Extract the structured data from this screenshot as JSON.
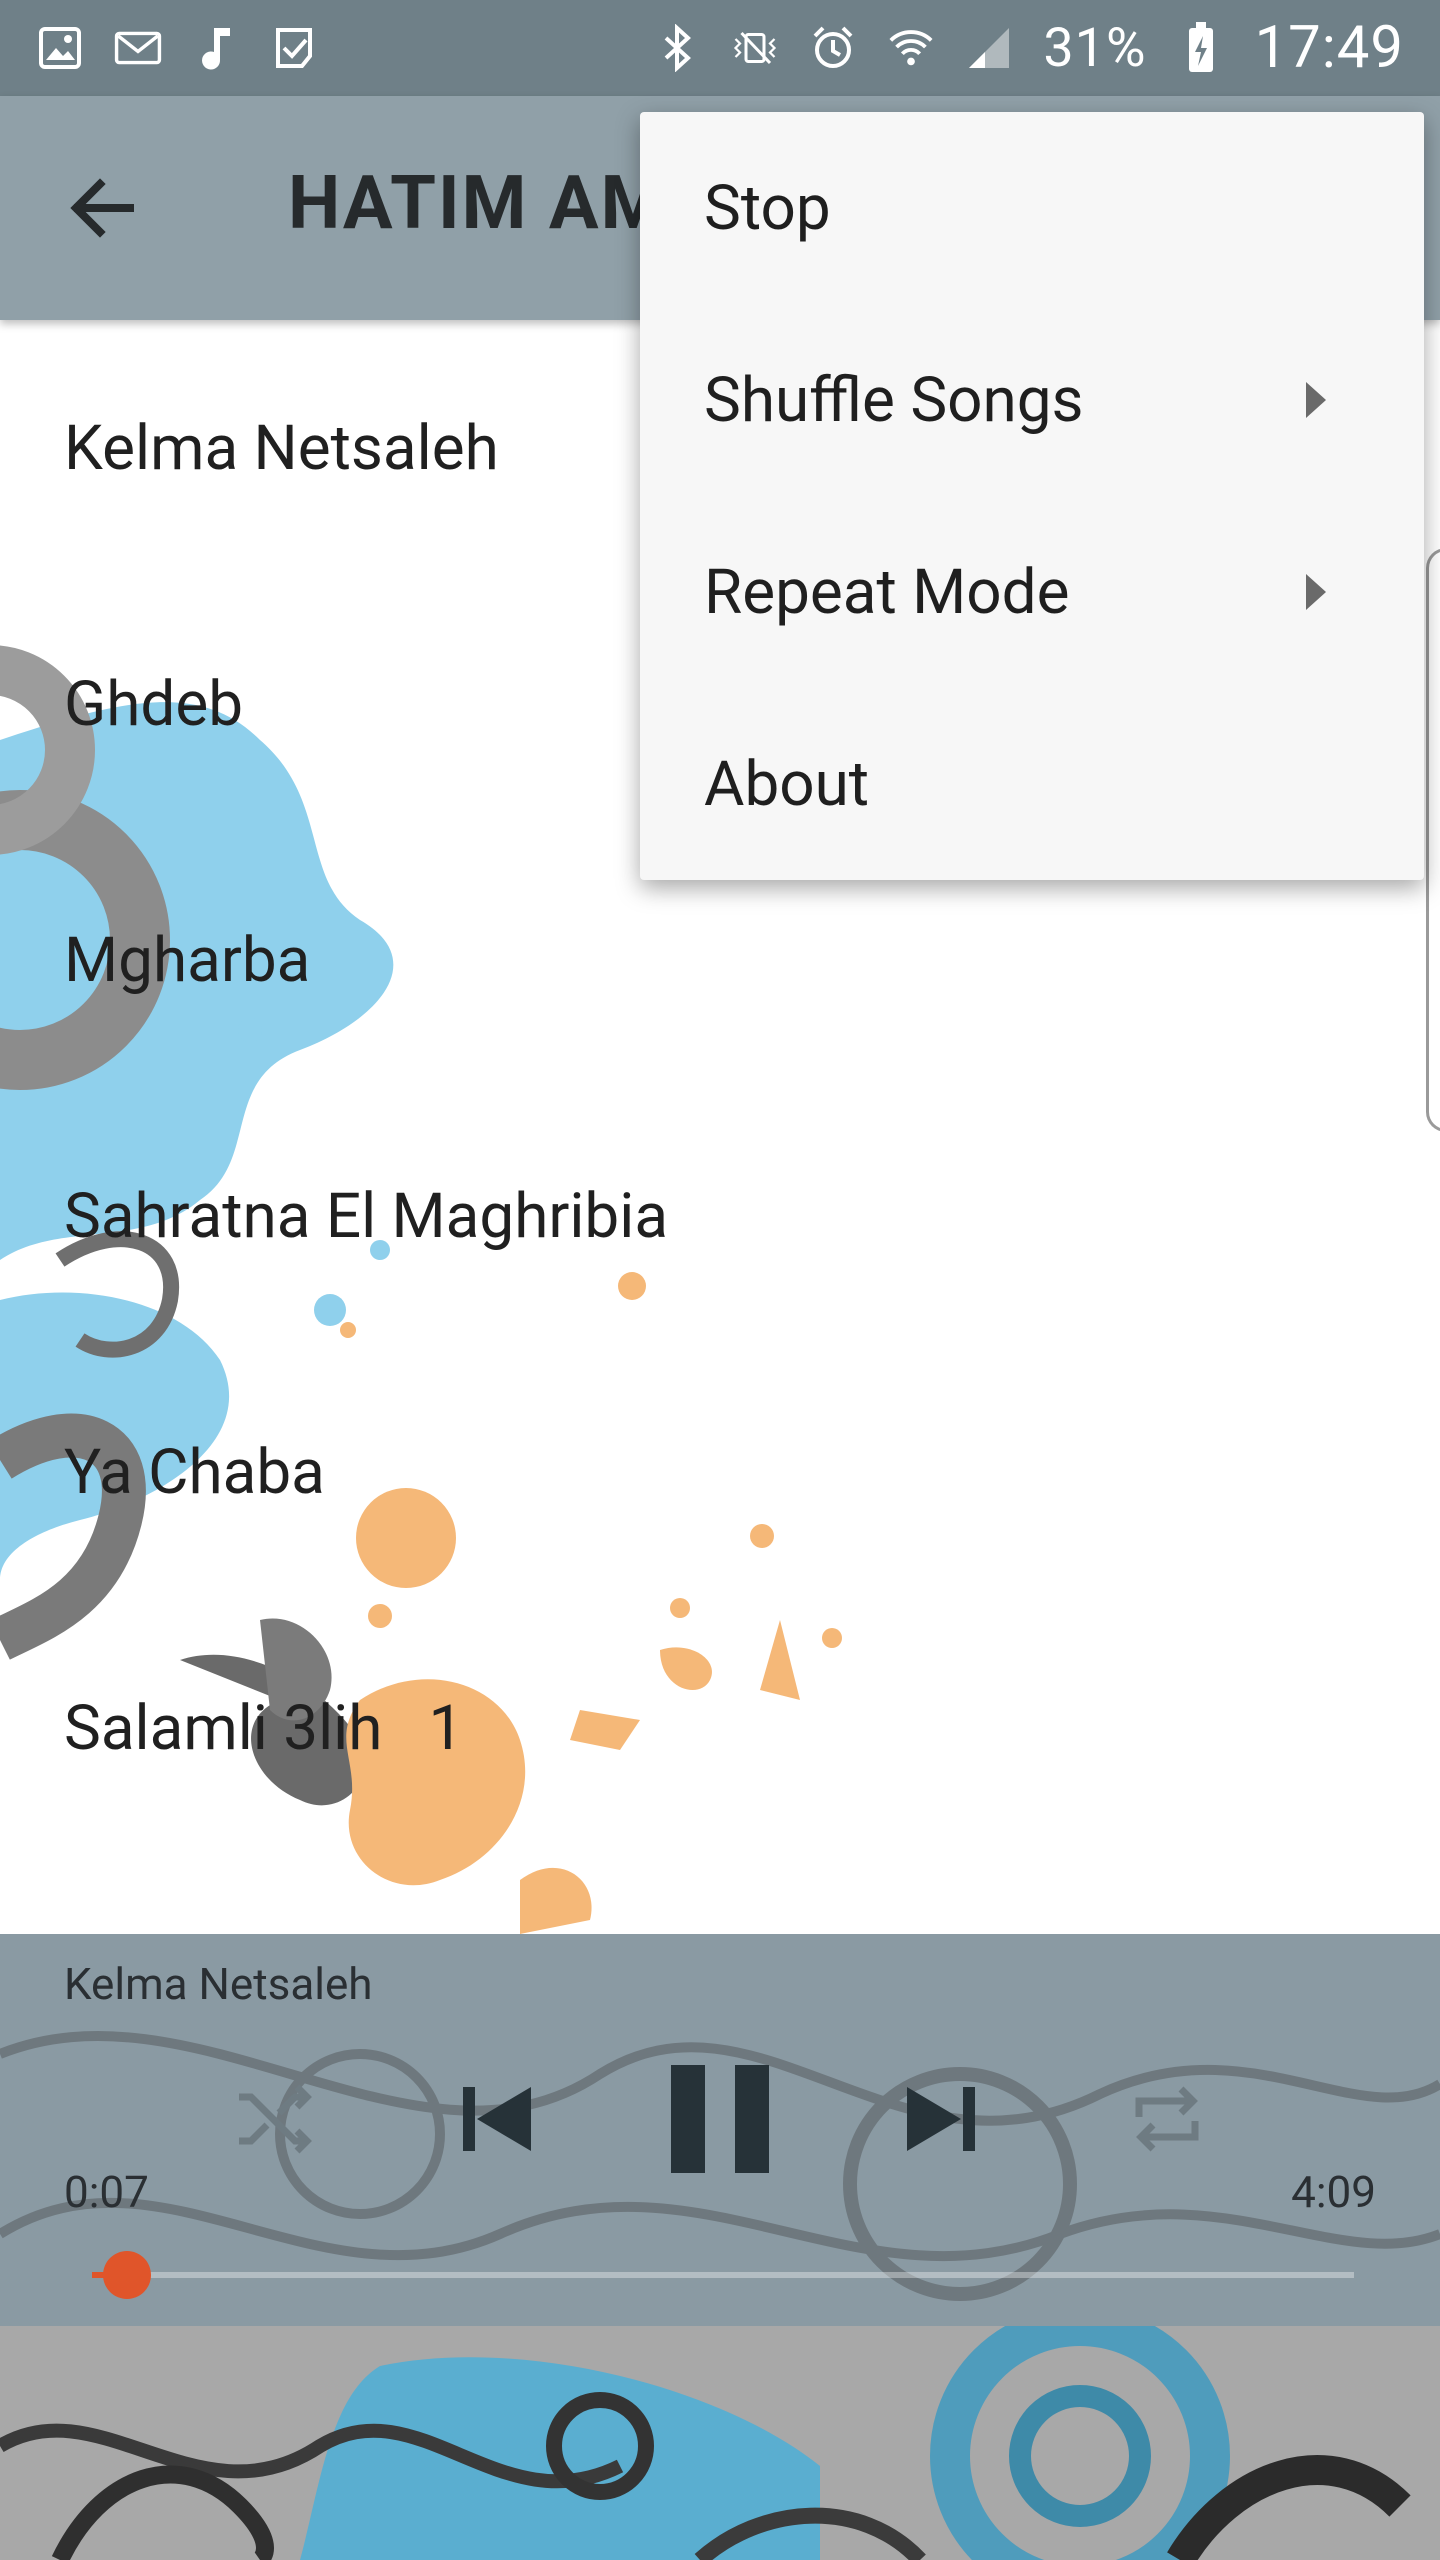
{
  "status_bar": {
    "battery_percent": "31%",
    "time": "17:49",
    "left_icons": [
      "gallery-icon",
      "gmail-icon",
      "music-note-icon",
      "download-done-icon"
    ],
    "right_icons": [
      "bluetooth-icon",
      "vibrate-icon",
      "alarm-icon",
      "wifi-icon",
      "signal-icon",
      "battery-charging-icon"
    ]
  },
  "app_bar": {
    "title": "HATIM AM",
    "back_icon": "arrow-back-icon",
    "color": "#90a0a8"
  },
  "songs": [
    {
      "title": "Kelma Netsaleh"
    },
    {
      "title": "Ghdeb"
    },
    {
      "title": "Mgharba"
    },
    {
      "title": "Sahratna El Maghribia"
    },
    {
      "title": "Ya Chaba"
    },
    {
      "title": "Salamli 3lih   1"
    }
  ],
  "player": {
    "now_playing": "Kelma Netsaleh",
    "current_time": "0:07",
    "total_time": "4:09",
    "progress": 0.028,
    "accent": "#e0552a",
    "controls": [
      "shuffle-icon",
      "skip-previous-icon",
      "pause-icon",
      "skip-next-icon",
      "repeat-icon"
    ]
  },
  "menu": {
    "items": [
      {
        "label": "Stop",
        "has_submenu": false
      },
      {
        "label": "Shuffle Songs",
        "has_submenu": true
      },
      {
        "label": "Repeat Mode",
        "has_submenu": true
      },
      {
        "label": "About",
        "has_submenu": false
      }
    ]
  }
}
